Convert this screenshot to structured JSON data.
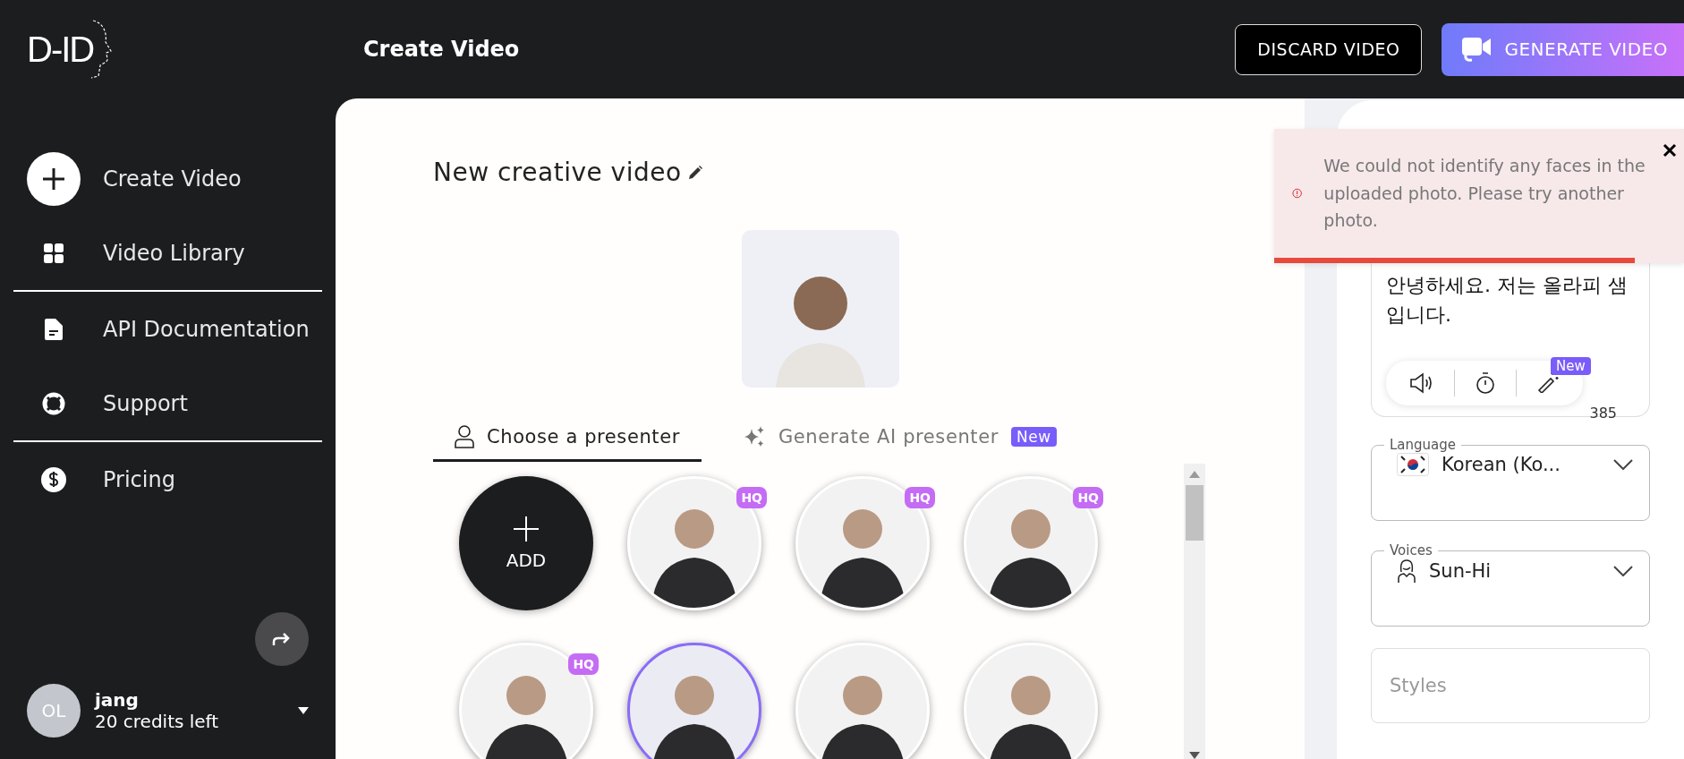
{
  "logo": "D-ID",
  "header": {
    "title": "Create Video",
    "buttons": [
      {
        "label": "DISCARD VIDEO",
        "kind": "outline"
      },
      {
        "label": "GENERATE VIDEO",
        "kind": "primary"
      }
    ]
  },
  "sidebar": {
    "sections": [
      [
        {
          "label": "Create Video",
          "kind": "plus"
        },
        {
          "label": "Video Library",
          "kind": "grid"
        }
      ],
      [
        {
          "label": "API Documentation",
          "kind": "doc"
        },
        {
          "label": "Support",
          "kind": "lifebuoy"
        }
      ],
      [
        {
          "label": "Pricing",
          "kind": "dollar"
        }
      ]
    ]
  },
  "user": {
    "initials": "OL",
    "name": "jang",
    "credits": "20 credits left"
  },
  "video_title": "New creative video",
  "tabs": [
    {
      "label": "Choose a presenter",
      "kind": "person",
      "selected": true
    },
    {
      "label": "Generate AI presenter",
      "kind": "sparkle",
      "selected": false,
      "badge": "New"
    }
  ],
  "add_label": "ADD",
  "presenters": [
    {
      "badge": "HQ",
      "selected": false
    },
    {
      "badge": "HQ",
      "selected": false
    },
    {
      "badge": "HQ",
      "selected": false
    },
    {
      "badge": "HQ",
      "selected": false
    },
    {
      "selected": true
    },
    {
      "selected": false
    },
    {
      "selected": false
    }
  ],
  "script": {
    "text": "안녕하세요. 저는 올라피 샘입니다.",
    "count": "385",
    "tools_badge": "New"
  },
  "language": {
    "label": "Language",
    "value": "Korean (Ko..."
  },
  "voices": {
    "label": "Voices",
    "value": "Sun-Hi"
  },
  "styles": {
    "placeholder": "Styles"
  },
  "toast": {
    "message": "We could not identify any faces in the uploaded photo. Please try another photo.",
    "level": 0.88
  }
}
